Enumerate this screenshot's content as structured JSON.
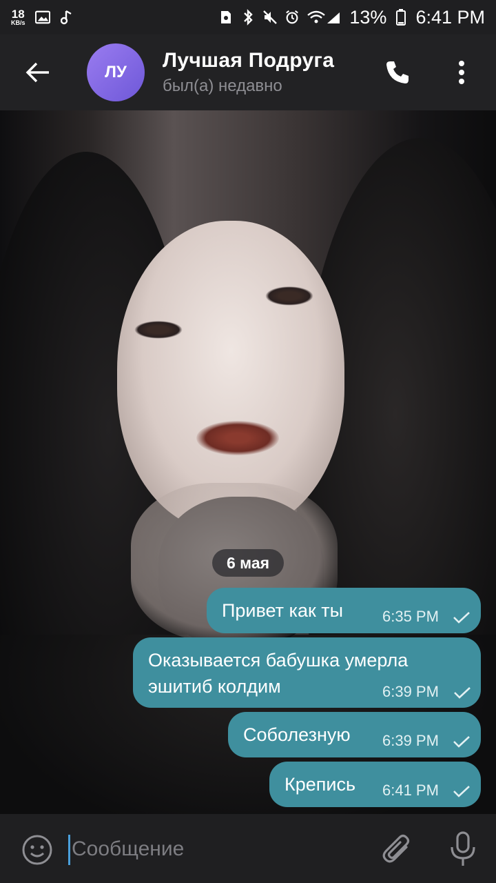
{
  "status_bar": {
    "net_speed": "18",
    "net_unit": "KB/s",
    "battery": "13%",
    "time": "6:41 PM",
    "left_icons": [
      "image-icon",
      "music-note-icon"
    ],
    "right_icons": [
      "sim-card-icon",
      "bluetooth-icon",
      "mute-icon",
      "alarm-icon",
      "wifi-icon",
      "signal-icon",
      "battery-icon"
    ]
  },
  "header": {
    "avatar_initials": "ЛУ",
    "name": "Лучшая Подруга",
    "status": "был(а) недавно"
  },
  "chat": {
    "date_label": "6 мая",
    "messages": [
      {
        "text": "Привет как ты",
        "time": "6:35 PM",
        "read": true
      },
      {
        "text_line1": "Оказывается бабушка умерла",
        "text_line2": "эшитиб колдим",
        "time": "6:39 PM",
        "read": true
      },
      {
        "text": "Соболезную",
        "time": "6:39 PM",
        "read": true
      },
      {
        "text": "Крепись",
        "time": "6:41 PM",
        "read": true
      }
    ]
  },
  "input": {
    "placeholder": "Сообщение"
  },
  "colors": {
    "bubble": "#3f8f9e",
    "header": "#222224",
    "accent_cursor": "#4a9fdb"
  }
}
